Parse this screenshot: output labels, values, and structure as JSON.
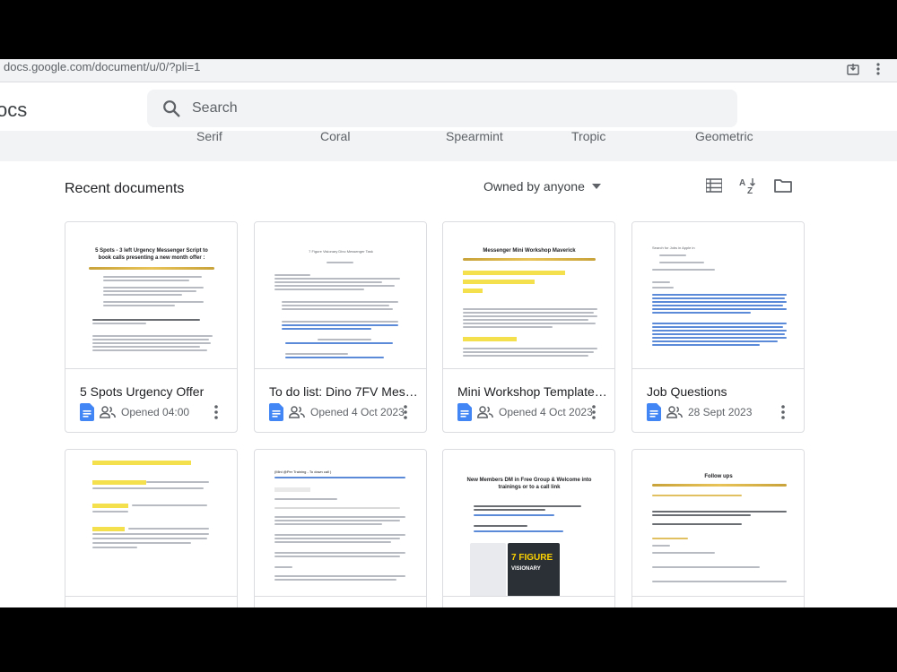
{
  "browser": {
    "url": "docs.google.com/document/u/0/?pli=1"
  },
  "header": {
    "app_name": "ocs",
    "search_placeholder": "Search"
  },
  "templates": {
    "labels": [
      "Serif",
      "Coral",
      "Spearmint",
      "Tropic",
      "Geometric"
    ]
  },
  "recent": {
    "title": "Recent documents",
    "owner_filter": "Owned by anyone"
  },
  "documents": [
    {
      "title": "5 Spots Urgency Offer",
      "opened": "Opened 04:00"
    },
    {
      "title": "To do list: Dino 7FV Mess...",
      "opened": "Opened 4 Oct 2023"
    },
    {
      "title": "Mini Workshop Template ...",
      "opened": "Opened 4 Oct 2023"
    },
    {
      "title": "Job Questions",
      "opened": "28 Sept 2023"
    },
    {
      "title": "",
      "opened": ""
    },
    {
      "title": "",
      "opened": ""
    },
    {
      "title": "",
      "opened": ""
    },
    {
      "title": "",
      "opened": ""
    }
  ],
  "thumbnails": {
    "t1_title": "5 Spots - 3 left Urgency Messenger Script to book calls presenting a new month offer :",
    "t2_title": "7 Figure Visionary Dino Messenger Task",
    "t3_title": "Messenger Mini Workshop Maverick",
    "t4_title": "Search for Jobs in Apple in",
    "t6_title": "(Mini @Per Training - To down call )",
    "t7_title": "New Members DM in Free Group & Welcome into trainings or to a call link",
    "t7_promo_a": "7 FIGURE",
    "t7_promo_b": "VISIONARY",
    "t8_title": "Follow ups"
  },
  "colors": {
    "docs_blue": "#4285f4",
    "highlight": "#f4e04d",
    "gold": "#d4af37"
  }
}
